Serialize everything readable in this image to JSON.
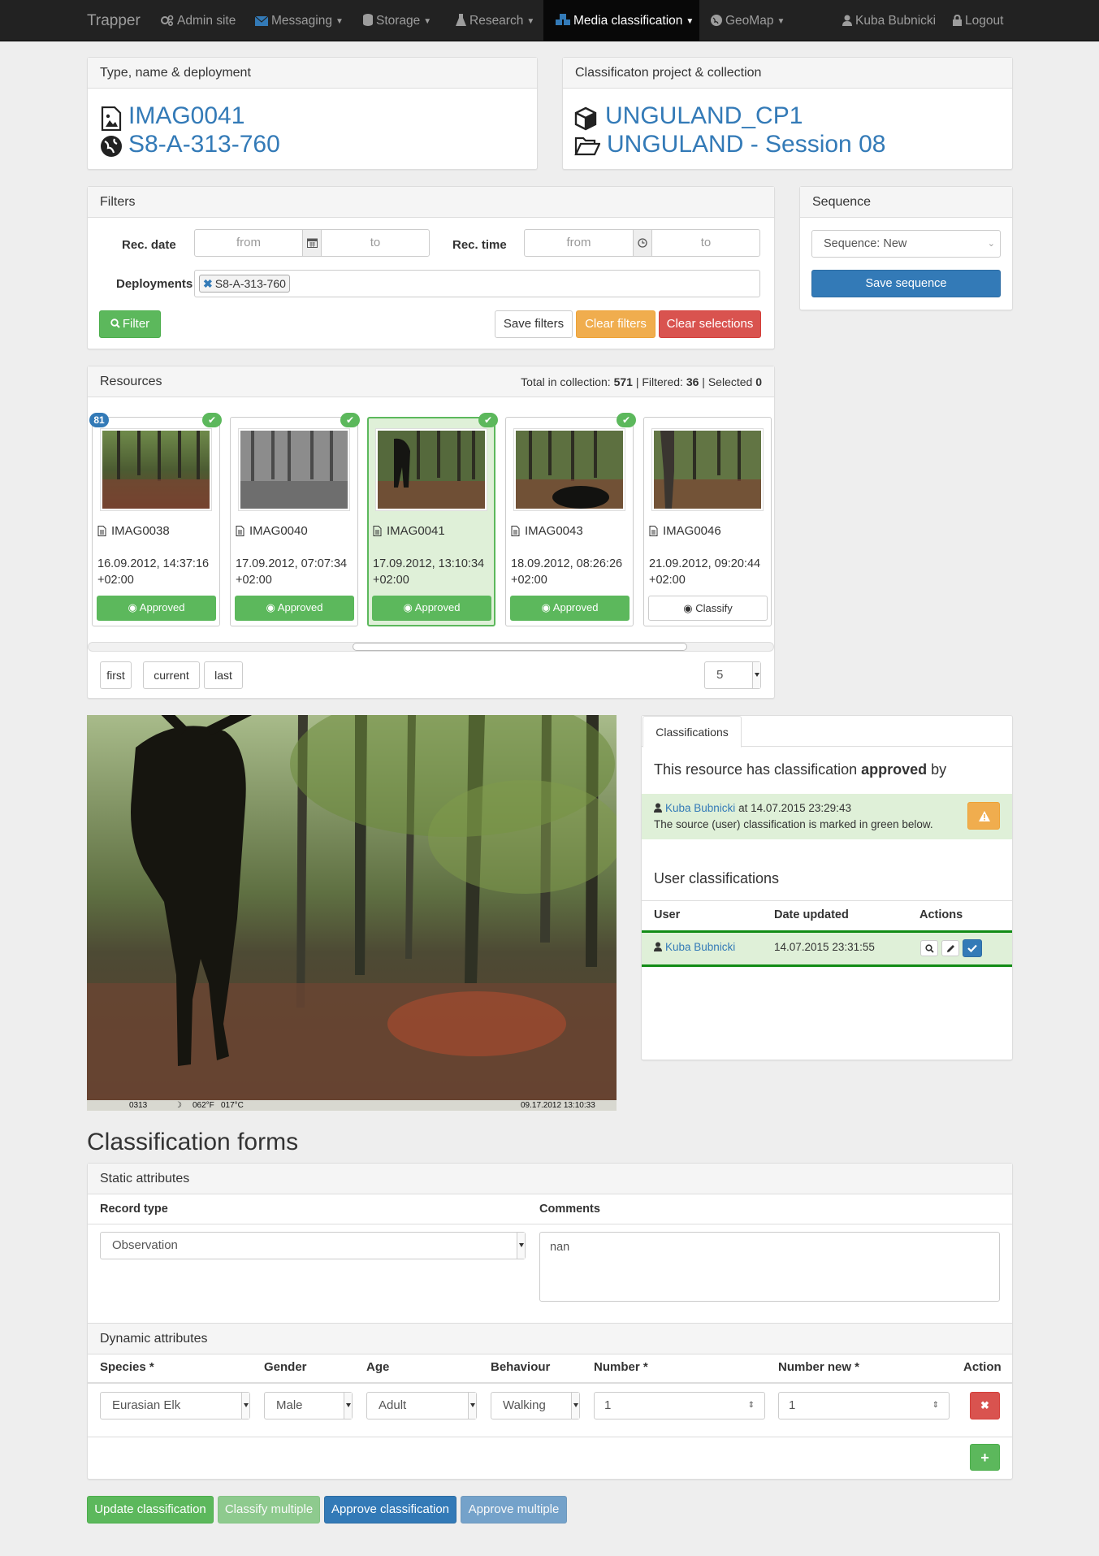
{
  "navbar": {
    "brand": "Trapper",
    "items": [
      {
        "label": "Admin site"
      },
      {
        "label": "Messaging"
      },
      {
        "label": "Storage"
      },
      {
        "label": "Research"
      },
      {
        "label": "Media classification"
      },
      {
        "label": "GeoMap"
      }
    ],
    "user": "Kuba Bubnicki",
    "logout": "Logout"
  },
  "type_panel": {
    "heading": "Type, name & deployment",
    "name": "IMAG0041",
    "deployment": "S8-A-313-760"
  },
  "project_panel": {
    "heading": "Classificaton project & collection",
    "project": "UNGULAND_CP1",
    "collection": "UNGULAND - Session 08"
  },
  "filters": {
    "heading": "Filters",
    "rec_date_label": "Rec. date",
    "rec_time_label": "Rec. time",
    "from": "from",
    "to": "to",
    "deployments_label": "Deployments",
    "deployment_tag": "S8-A-313-760",
    "filter_btn": "Filter",
    "save_btn": "Save filters",
    "clear_btn": "Clear filters",
    "clear_sel_btn": "Clear selections"
  },
  "sequence": {
    "heading": "Sequence",
    "select_value": "Sequence: New",
    "save_btn": "Save sequence"
  },
  "resources": {
    "heading": "Resources",
    "total_label": "Total in collection:",
    "total": "571",
    "filtered_label": "Filtered:",
    "filtered": "36",
    "selected_label": "Selected",
    "selected": "0",
    "badge": "81",
    "items": [
      {
        "name": "IMAG0038",
        "date": "16.09.2012, 14:37:16",
        "tz": "+02:00",
        "button": "Approved"
      },
      {
        "name": "IMAG0040",
        "date": "17.09.2012, 07:07:34",
        "tz": "+02:00",
        "button": "Approved"
      },
      {
        "name": "IMAG0041",
        "date": "17.09.2012, 13:10:34",
        "tz": "+02:00",
        "button": "Approved"
      },
      {
        "name": "IMAG0043",
        "date": "18.09.2012, 08:26:26",
        "tz": "+02:00",
        "button": "Approved"
      },
      {
        "name": "IMAG0046",
        "date": "21.09.2012, 09:20:44",
        "tz": "+02:00",
        "button": "Classify"
      }
    ],
    "nav_first": "first",
    "nav_current": "current",
    "nav_last": "last",
    "page_size": "5"
  },
  "photo": {
    "counter": "0313",
    "temp_f": "062°F",
    "temp_c": "017°C",
    "timestamp": "09.17.2012 13:10:33"
  },
  "classifications": {
    "tab": "Classifications",
    "title_pre": "This resource has classification",
    "title_bold": "approved",
    "title_post": "by",
    "approver": "Kuba Bubnicki",
    "approved_at": "at 14.07.2015 23:29:43",
    "note": "The source (user) classification is marked in green below.",
    "user_heading": "User classifications",
    "col_user": "User",
    "col_date": "Date updated",
    "col_actions": "Actions",
    "row_user": "Kuba Bubnicki",
    "row_date": "14.07.2015 23:31:55"
  },
  "forms": {
    "heading": "Classification forms",
    "static_heading": "Static attributes",
    "record_type_label": "Record type",
    "record_type": "Observation",
    "comments_label": "Comments",
    "comments": "nan",
    "dynamic_heading": "Dynamic attributes",
    "cols": [
      "Species *",
      "Gender",
      "Age",
      "Behaviour",
      "Number *",
      "Number new *",
      "Action"
    ],
    "row": {
      "species": "Eurasian Elk",
      "gender": "Male",
      "age": "Adult",
      "behaviour": "Walking",
      "number": "1",
      "number_new": "1"
    }
  },
  "footer_buttons": {
    "update": "Update classification",
    "classify_multiple": "Classify multiple",
    "approve": "Approve classification",
    "approve_multiple": "Approve multiple"
  }
}
